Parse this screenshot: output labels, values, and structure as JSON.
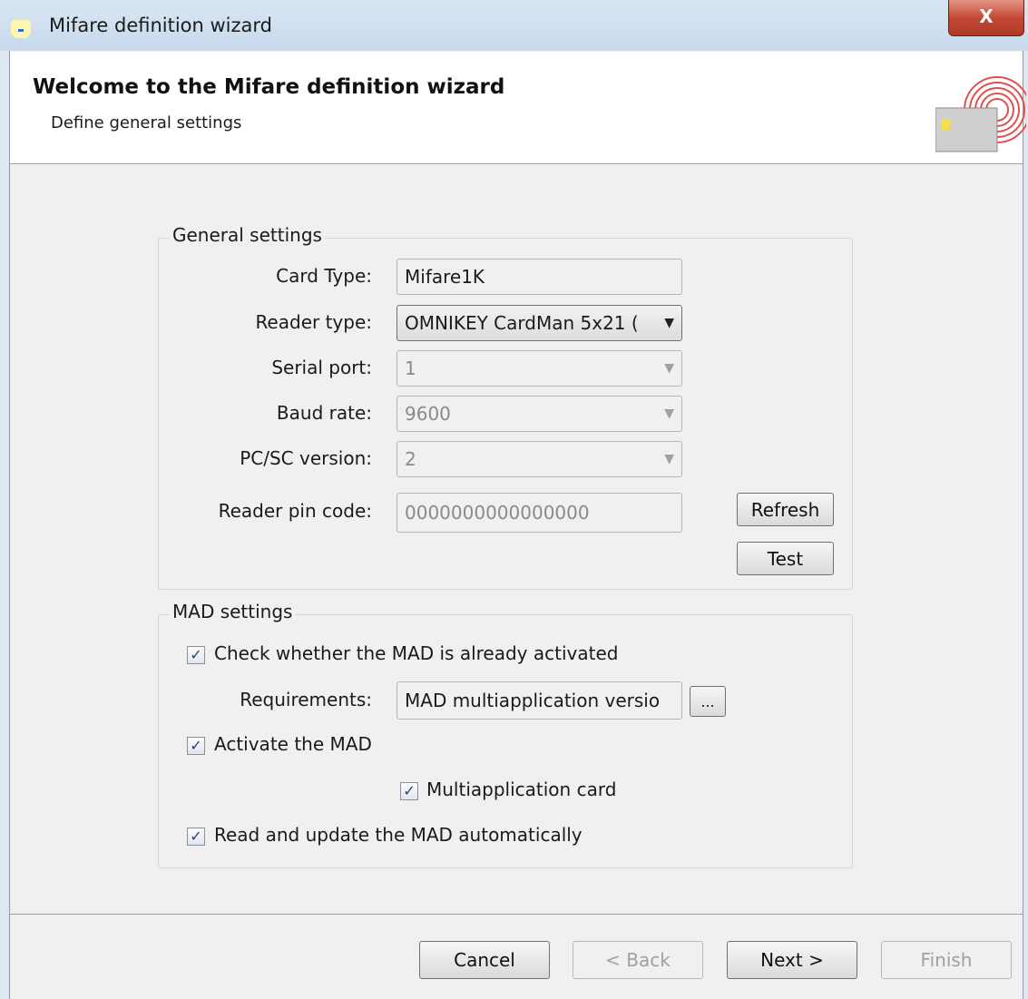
{
  "window": {
    "title": "Mifare definition wizard",
    "close_label": "X"
  },
  "header": {
    "title": "Welcome to the Mifare definition wizard",
    "subtitle": "Define general settings"
  },
  "general_settings": {
    "legend": "General settings",
    "card_type": {
      "label": "Card Type:",
      "value": "Mifare1K"
    },
    "reader_type": {
      "label": "Reader type:",
      "value": "OMNIKEY CardMan 5x21 ("
    },
    "serial_port": {
      "label": "Serial port:",
      "value": "1"
    },
    "baud_rate": {
      "label": "Baud rate:",
      "value": "9600"
    },
    "pcsc_version": {
      "label": "PC/SC version:",
      "value": "2"
    },
    "reader_pin": {
      "label": "Reader pin code:",
      "value": "0000000000000000"
    },
    "refresh_label": "Refresh",
    "test_label": "Test"
  },
  "mad_settings": {
    "legend": "MAD settings",
    "check_activated": {
      "label": "Check whether the MAD is already activated",
      "checked": true
    },
    "requirements": {
      "label": "Requirements:",
      "value": "MAD multiapplication versio"
    },
    "browse_label": "...",
    "activate_mad": {
      "label": "Activate the MAD",
      "checked": true
    },
    "multiapplication": {
      "label": "Multiapplication card",
      "checked": true
    },
    "read_update": {
      "label": "Read and update the MAD automatically",
      "checked": true
    },
    "check_glyph": "✓"
  },
  "footer": {
    "cancel": "Cancel",
    "back": "< Back",
    "next": "Next >",
    "finish": "Finish"
  }
}
